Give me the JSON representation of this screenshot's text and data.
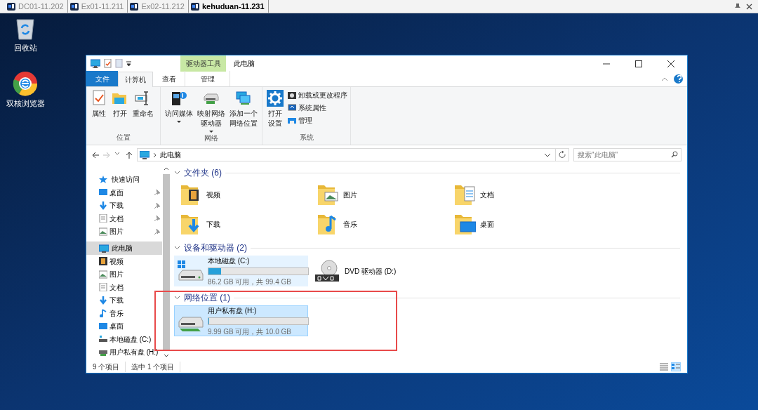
{
  "rdp_tabs": [
    {
      "label": "DC01-11.202",
      "selected": false
    },
    {
      "label": "Ex01-11.211",
      "selected": false
    },
    {
      "label": "Ex02-11.212",
      "selected": false
    },
    {
      "label": "kehuduan-11.231",
      "selected": true
    }
  ],
  "desktop_icons": [
    {
      "label": "回收站",
      "kind": "recycle"
    },
    {
      "label": "双核浏览器",
      "kind": "browser"
    }
  ],
  "window": {
    "title": "此电脑",
    "context_group": "驱动器工具"
  },
  "ribbon_tabs": [
    {
      "label": "文件",
      "kind": "file",
      "selected": false
    },
    {
      "label": "计算机",
      "kind": "normal",
      "selected": true
    },
    {
      "label": "查看",
      "kind": "normal",
      "selected": false
    },
    {
      "label": "管理",
      "kind": "context",
      "selected": false
    }
  ],
  "ribbon_groups": [
    {
      "label": "位置",
      "buttons": [
        {
          "label": "属性",
          "kind": "large",
          "dropdown": false
        },
        {
          "label": "打开",
          "kind": "large",
          "dropdown": false
        },
        {
          "label": "重命名",
          "kind": "large",
          "dropdown": false
        }
      ]
    },
    {
      "label": "网络",
      "buttons": [
        {
          "label": "访问媒体",
          "kind": "large",
          "dropdown": true
        },
        {
          "label": [
            "映射网络",
            "驱动器"
          ],
          "kind": "large",
          "dropdown": true
        },
        {
          "label": [
            "添加一个",
            "网络位置"
          ],
          "kind": "large",
          "dropdown": false
        }
      ]
    },
    {
      "label": "系统",
      "buttons": [
        {
          "label": [
            "打开",
            "设置"
          ],
          "kind": "large",
          "dropdown": false
        },
        {
          "label": "卸载或更改程序",
          "kind": "small"
        },
        {
          "label": "系统属性",
          "kind": "small"
        },
        {
          "label": "管理",
          "kind": "small"
        }
      ]
    }
  ],
  "address": {
    "path": "此电脑"
  },
  "search": {
    "placeholder": "搜索\"此电脑\""
  },
  "nav": [
    {
      "label": "快速访问",
      "selected": false,
      "children": [
        {
          "label": "桌面",
          "pinned": true,
          "selected": false
        },
        {
          "label": "下载",
          "pinned": true,
          "selected": false
        },
        {
          "label": "文档",
          "pinned": true,
          "selected": false
        },
        {
          "label": "图片",
          "pinned": true,
          "selected": false
        }
      ]
    },
    {
      "label": "此电脑",
      "selected": true,
      "children": [
        {
          "label": "视频",
          "pinned": false,
          "selected": false
        },
        {
          "label": "图片",
          "pinned": false,
          "selected": false
        },
        {
          "label": "文档",
          "pinned": false,
          "selected": false
        },
        {
          "label": "下载",
          "pinned": false,
          "selected": false
        },
        {
          "label": "音乐",
          "pinned": false,
          "selected": false
        },
        {
          "label": "桌面",
          "pinned": false,
          "selected": false
        },
        {
          "label": "本地磁盘 (C:)",
          "pinned": false,
          "selected": false
        },
        {
          "label": "用户私有盘 (H:)",
          "pinned": false,
          "selected": false
        }
      ]
    }
  ],
  "sections": [
    {
      "title": "文件夹 (6)",
      "expanded": true,
      "highlighted": false,
      "items": [
        {
          "kind": "folder",
          "label": "视频"
        },
        {
          "kind": "folder",
          "label": "图片"
        },
        {
          "kind": "folder",
          "label": "文档"
        },
        {
          "kind": "folder",
          "label": "下载"
        },
        {
          "kind": "folder",
          "label": "音乐"
        },
        {
          "kind": "folder",
          "label": "桌面"
        }
      ]
    },
    {
      "title": "设备和驱动器 (2)",
      "expanded": true,
      "highlighted": false,
      "items": [
        {
          "kind": "drive",
          "label": "本地磁盘 (C:)",
          "level": 0.13,
          "space": "86.2 GB 可用，共 99.4 GB",
          "selected": false,
          "hovered": true
        },
        {
          "kind": "optical",
          "label": "DVD 驱动器 (D:)",
          "selected": false,
          "hovered": false
        }
      ]
    },
    {
      "title": "网络位置 (1)",
      "expanded": true,
      "highlighted": true,
      "items": [
        {
          "kind": "netdrive",
          "label": "用户私有盘 (H:)",
          "level": 0.01,
          "space": "9.99 GB 可用，共 10.0 GB",
          "selected": true,
          "hovered": false
        }
      ]
    }
  ],
  "status": {
    "count": "9 个项目",
    "selection": "选中 1 个项目"
  }
}
